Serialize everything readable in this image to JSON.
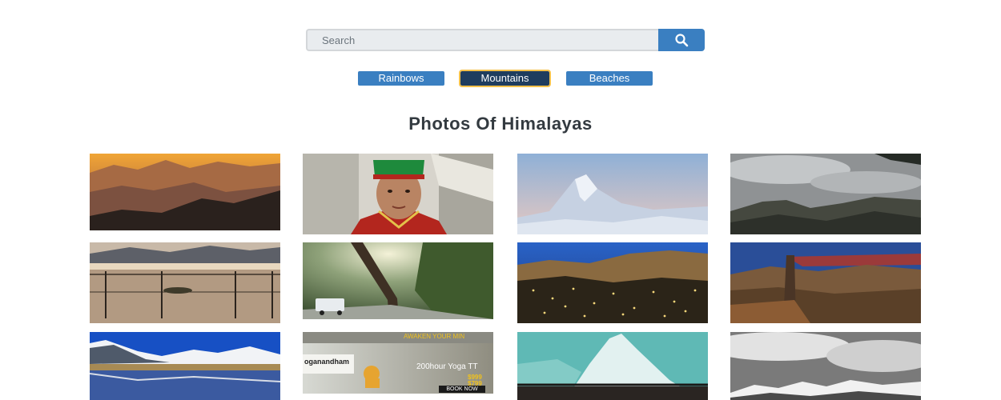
{
  "search": {
    "placeholder": "Search",
    "value": "",
    "button_icon": "search-icon"
  },
  "tags": [
    {
      "label": "Rainbows",
      "active": false
    },
    {
      "label": "Mountains",
      "active": true
    },
    {
      "label": "Beaches",
      "active": false
    }
  ],
  "gallery": {
    "title": "Photos Of Himalayas",
    "ad": {
      "brand": "oganandham",
      "headline": "AWAKEN YOUR MIN",
      "sub": "200hour Yoga TT",
      "price1": "$999",
      "price2": "$799",
      "cta": "BOOK NOW"
    }
  },
  "colors": {
    "accent": "#3a7fc1",
    "active_tag": "#1f3d5e",
    "active_outline": "#f5c14a",
    "title": "#333a40"
  }
}
